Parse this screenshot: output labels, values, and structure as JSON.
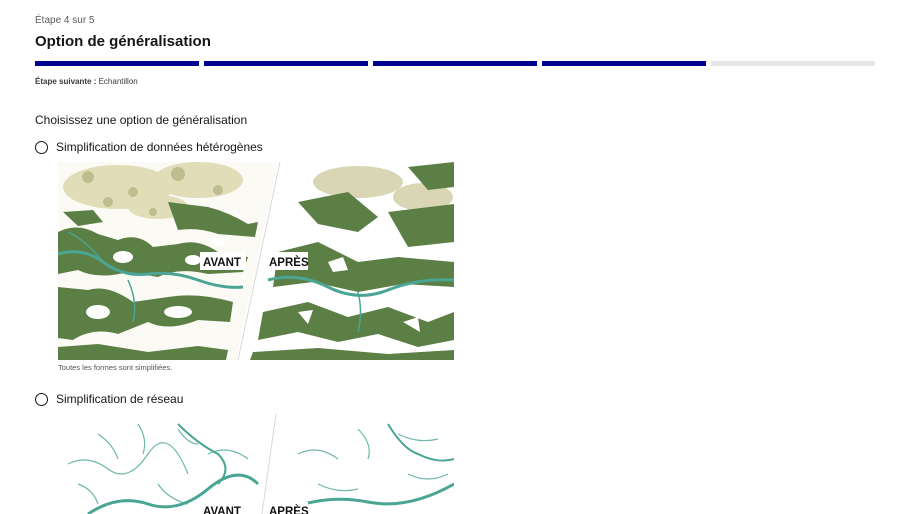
{
  "step": {
    "counter": "Étape 4 sur 5",
    "title": "Option de généralisation"
  },
  "stepper": {
    "current": 4,
    "total": 5
  },
  "next": {
    "label": "Étape suivante :",
    "value": "Echantillon"
  },
  "form": {
    "legend": "Choisissez une option de généralisation"
  },
  "options": [
    {
      "label": "Simplification de données hétérogènes",
      "selected": false,
      "before": "AVANT",
      "after": "APRÈS",
      "caption": "Toutes les formes sont simplifiées."
    },
    {
      "label": "Simplification de réseau",
      "selected": false,
      "before": "AVANT",
      "after": "APRÈS"
    }
  ],
  "colors": {
    "primary": "#000091",
    "forest": "#5b7f45",
    "water": "#4aa594",
    "urban": "#c8c48e",
    "inactive": "#e6e6e6"
  }
}
